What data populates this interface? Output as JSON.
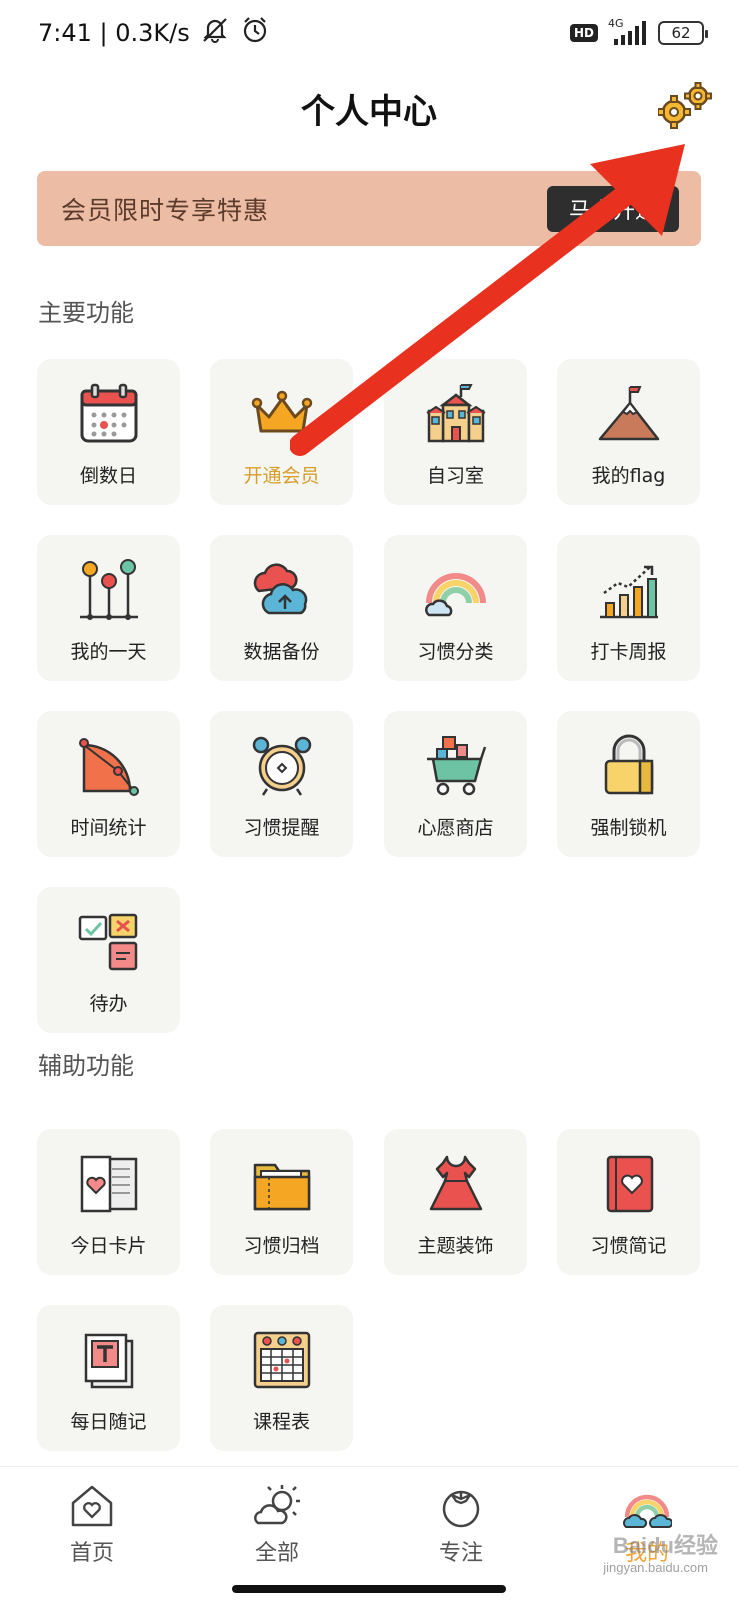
{
  "status_bar": {
    "time_speed": "7:41 | 0.3K/s",
    "network": "4G",
    "hd": "HD",
    "battery": "62"
  },
  "header": {
    "title": "个人中心",
    "settings_icon": "gear-icon"
  },
  "promo": {
    "text": "会员限时专享特惠",
    "button_label": "马上开通"
  },
  "main_section": {
    "title": "主要功能",
    "items": [
      {
        "label": "倒数日",
        "icon": "calendar-icon"
      },
      {
        "label": "开通会员",
        "icon": "crown-icon",
        "highlight_color": "#d89d2a"
      },
      {
        "label": "自习室",
        "icon": "school-icon"
      },
      {
        "label": "我的flag",
        "icon": "mountain-flag-icon"
      },
      {
        "label": "我的一天",
        "icon": "timeline-icon"
      },
      {
        "label": "数据备份",
        "icon": "cloud-backup-icon"
      },
      {
        "label": "习惯分类",
        "icon": "rainbow-icon"
      },
      {
        "label": "打卡周报",
        "icon": "bar-chart-icon"
      },
      {
        "label": "时间统计",
        "icon": "pie-stat-icon"
      },
      {
        "label": "习惯提醒",
        "icon": "alarm-clock-icon"
      },
      {
        "label": "心愿商店",
        "icon": "shopping-cart-icon"
      },
      {
        "label": "强制锁机",
        "icon": "padlock-icon"
      },
      {
        "label": "待办",
        "icon": "todo-notes-icon"
      }
    ]
  },
  "aux_section": {
    "title": "辅助功能",
    "items": [
      {
        "label": "今日卡片",
        "icon": "heart-card-icon"
      },
      {
        "label": "习惯归档",
        "icon": "folder-icon"
      },
      {
        "label": "主题装饰",
        "icon": "dress-icon"
      },
      {
        "label": "习惯简记",
        "icon": "heart-book-icon"
      },
      {
        "label": "每日随记",
        "icon": "text-note-icon"
      },
      {
        "label": "课程表",
        "icon": "timetable-icon"
      }
    ]
  },
  "bottom_nav": [
    {
      "label": "首页",
      "icon": "home-heart-icon"
    },
    {
      "label": "全部",
      "icon": "sun-cloud-icon"
    },
    {
      "label": "专注",
      "icon": "tomato-icon"
    },
    {
      "label": "我的",
      "icon": "rainbow-cloud-icon",
      "active": true
    }
  ],
  "colors": {
    "promo_bg": "#ecbca4",
    "active_tab": "#f0a43a",
    "arrow": "#e8321f"
  },
  "watermark": {
    "brand": "Baidu经验",
    "url": "jingyan.baidu.com"
  }
}
